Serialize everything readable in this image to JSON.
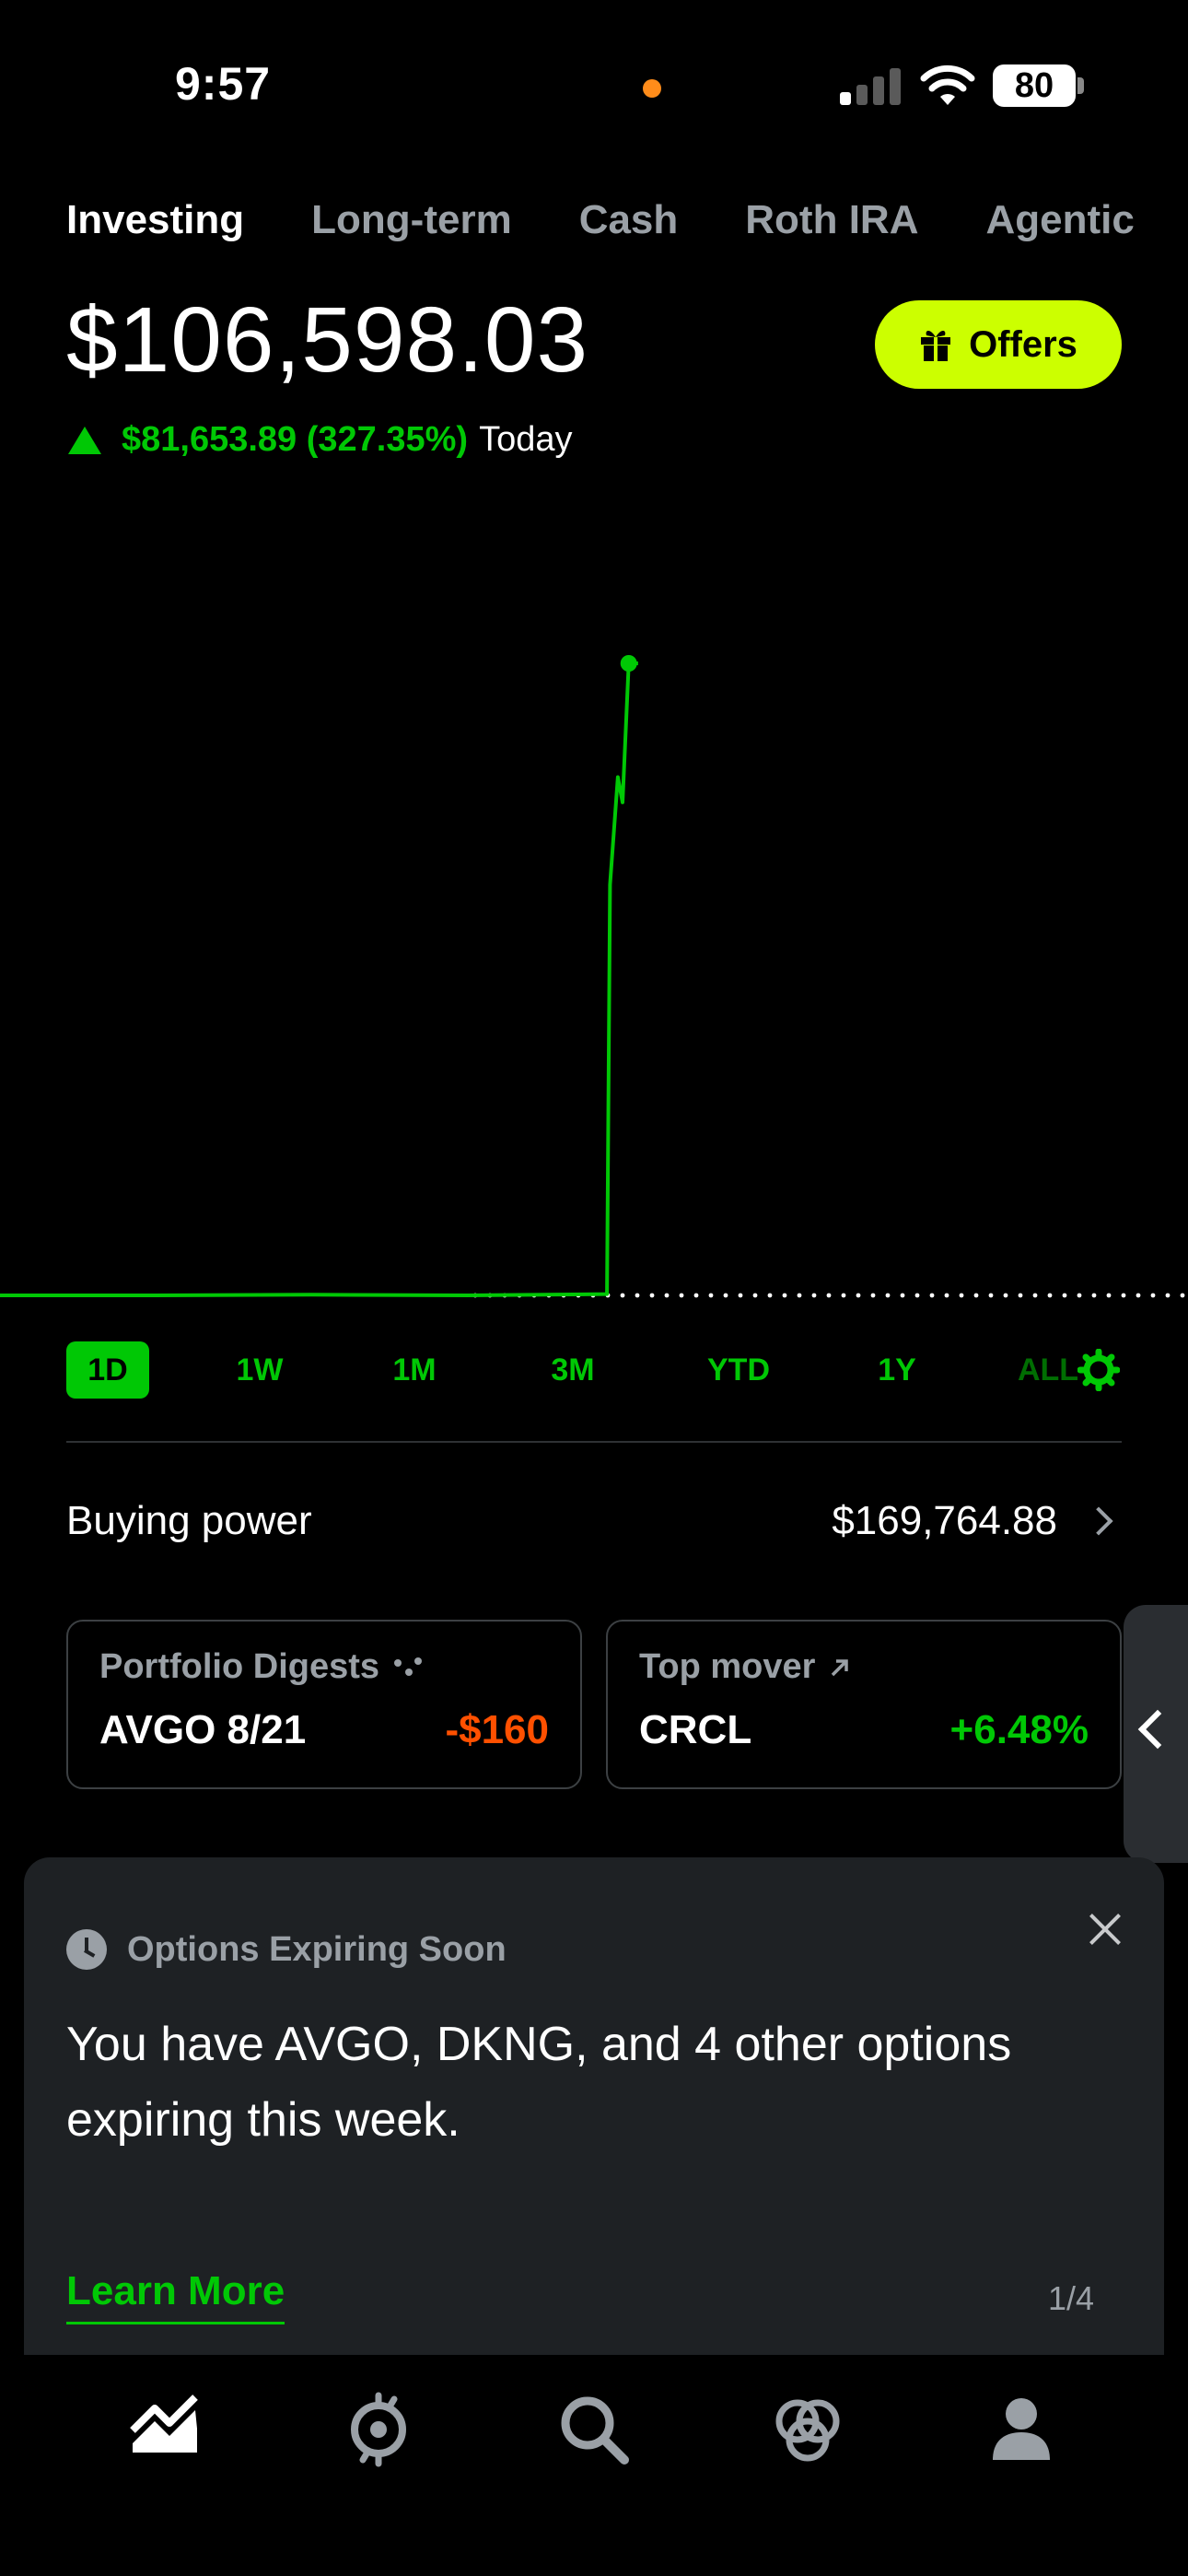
{
  "status_bar": {
    "time": "9:57",
    "battery": "80"
  },
  "tabs": [
    {
      "label": "Investing",
      "active": true
    },
    {
      "label": "Long-term",
      "active": false
    },
    {
      "label": "Cash",
      "active": false
    },
    {
      "label": "Roth IRA",
      "active": false
    },
    {
      "label": "Agentic",
      "active": false
    }
  ],
  "portfolio": {
    "value": "$106,598.03",
    "change": "$81,653.89 (327.35%)",
    "change_period": "Today",
    "offers_label": "Offers"
  },
  "chart_data": {
    "type": "line",
    "series_color": "#00c805",
    "points": [
      [
        0,
        0
      ],
      [
        0.1,
        0.0
      ],
      [
        0.2,
        0.001
      ],
      [
        0.3,
        0.0
      ],
      [
        0.39,
        0.002
      ],
      [
        0.392,
        0.65
      ],
      [
        0.397,
        0.82
      ],
      [
        0.4,
        0.78
      ],
      [
        0.404,
        1.0
      ],
      [
        0.41,
        1.0
      ]
    ],
    "baseline": "dotted"
  },
  "ranges": [
    {
      "label": "1D",
      "active": true
    },
    {
      "label": "1W",
      "active": false
    },
    {
      "label": "1M",
      "active": false
    },
    {
      "label": "3M",
      "active": false
    },
    {
      "label": "YTD",
      "active": false
    },
    {
      "label": "1Y",
      "active": false
    },
    {
      "label": "ALL",
      "active": false
    }
  ],
  "buying_power": {
    "label": "Buying power",
    "value": "$169,764.88"
  },
  "cards": {
    "digest": {
      "title": "Portfolio Digests",
      "item": "AVGO 8/21",
      "value": "-$160"
    },
    "top_mover": {
      "title": "Top mover",
      "item": "CRCL",
      "value": "+6.48%"
    }
  },
  "notification": {
    "title": "Options Expiring Soon",
    "message": "You have AVGO, DKNG, and 4 other options expiring this week.",
    "action": "Learn More",
    "pager": "1/4"
  },
  "nav": [
    "investing-icon",
    "crypto-icon",
    "search-icon",
    "network-icon",
    "account-icon"
  ],
  "colors": {
    "green": "#00c805",
    "red": "#ff5000",
    "accent": "#ccff00",
    "card": "#1e2124"
  }
}
